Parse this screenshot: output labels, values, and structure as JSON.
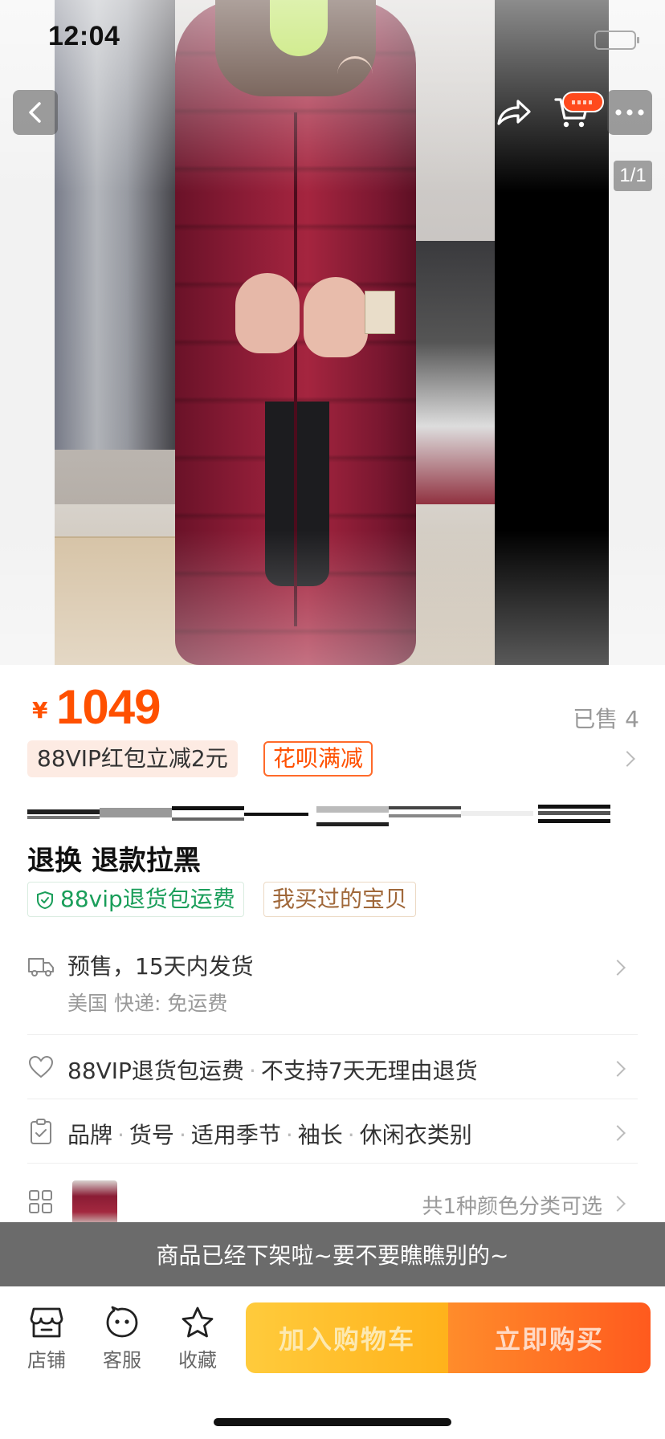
{
  "status_bar": {
    "time": "12:04"
  },
  "gallery": {
    "page_indicator": "1/1"
  },
  "product": {
    "currency": "¥",
    "price": "1049",
    "sold": "已售 4",
    "promo_vip": "88VIP红包立减2元",
    "promo_huabei": "花呗满减",
    "title": "退换 退款拉黑",
    "tag_return": "88vip退货包运费",
    "tag_bought": "我买过的宝贝"
  },
  "shipping": {
    "label": "预售，15天内发货",
    "detail": "美国  快递: 免运费"
  },
  "service": {
    "item1": "88VIP退货包运费",
    "item2": "不支持7天无理由退货"
  },
  "specs": {
    "items": [
      "品牌",
      "货号",
      "适用季节",
      "袖长",
      "休闲衣类别"
    ]
  },
  "variants": {
    "text": "共1种颜色分类可选"
  },
  "banner": {
    "text": "商品已经下架啦~要不要瞧瞧别的~"
  },
  "bottom_bar": {
    "store": "店铺",
    "service": "客服",
    "favorite": "收藏",
    "add_to_cart": "加入购物车",
    "buy_now": "立即购买"
  },
  "colors": {
    "accent": "#ff5000",
    "green": "#1a9e5a",
    "banner": "#6b6b6b"
  }
}
